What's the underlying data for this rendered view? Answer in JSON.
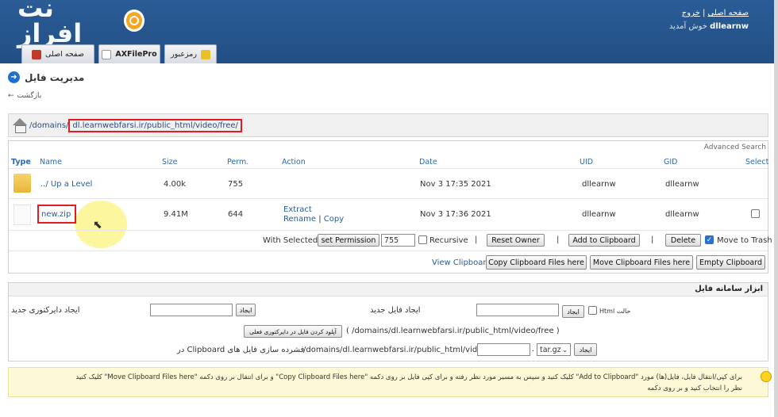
{
  "header": {
    "logo_text": "نت افراز",
    "links": {
      "home": "صفحه اصلی",
      "sep": "|",
      "logout": "خروج"
    },
    "welcome_user": "dllearnw",
    "welcome_text": "خوش آمدید"
  },
  "tabs": [
    {
      "label": "رمزعبور",
      "icon": "key-icon"
    },
    {
      "label": "AXFilePro",
      "icon": "document-icon"
    },
    {
      "label": "صفحه اصلی",
      "icon": "home-icon"
    }
  ],
  "page": {
    "title": "مدیریت فایل",
    "back": "بازگشت",
    "path": "/domains/dl.learnwebfarsi.ir/public_html/video/free/",
    "path_prefix": "/domains/",
    "path_highlight": "dl.learnwebfarsi.ir/public_html/video/free/"
  },
  "table": {
    "advanced_search": "Advanced Search",
    "columns": [
      "Type",
      "Name",
      "Size",
      "Perm.",
      "Action",
      "Date",
      "UID",
      "GID",
      "Select"
    ],
    "rows": [
      {
        "name": "../ Up a Level",
        "size": "4.00k",
        "perm": "755",
        "date": "Nov 3 17:35 2021",
        "uid": "dllearnw",
        "gid": "dllearnw"
      },
      {
        "name": "new.zip",
        "size": "9.41M",
        "perm": "644",
        "actions": [
          "Extract",
          "Rename",
          "|",
          "Copy"
        ],
        "date": "Nov 3 17:36 2021",
        "uid": "dllearnw",
        "gid": "dllearnw",
        "selected": false
      }
    ],
    "with_selected": "With Selected",
    "set_permission": "set Permission",
    "perm_value": "755",
    "recursive": "Recursive",
    "bar": "|",
    "reset_owner": "Reset Owner",
    "add_clipboard": "Add to Clipboard",
    "delete": "Delete",
    "move_trash": "Move to Trash",
    "move_trash_checked": true,
    "view_clipboard": "View Clipboard",
    "copy_clip": "Copy Clipboard Files here",
    "move_clip": "Move Clipboard Files here",
    "empty_clip": "Empty Clipboard"
  },
  "tools": {
    "title": "ابزار سامانه فایل",
    "new_dir": "ایجاد دایرکتوری جدید",
    "new_file": "ایجاد فایل جدید",
    "create": "ایجاد",
    "html_mode": "حالت Html",
    "upload_btn": "آپلود کردن فایل در دایرکتوری فعلی",
    "upload_path": "( /domains/dl.learnwebfarsi.ir/public_html/video/free )",
    "compress_label": "فشرده سازی فایل های Clipboard در",
    "compress_path": "/domains/dl.learnwebfarsi.ir/public_html/video/free",
    "dot": ".",
    "format": "tar.gz"
  },
  "note": {
    "line1": "برای کپی/انتقال فایل، فایل(ها) مورد \"Add to Clipboard\" کلیک کنید و سپس به مسیر مورد نظر رفته و برای کپی فایل بر روی دکمه \"Copy Clipboard Files here\" و برای انتقال بر روی دکمه \"Move Clipboard Files here\" کلیک کنید",
    "line2": "نظر را انتخاب کنید و بر روی دکمه"
  }
}
